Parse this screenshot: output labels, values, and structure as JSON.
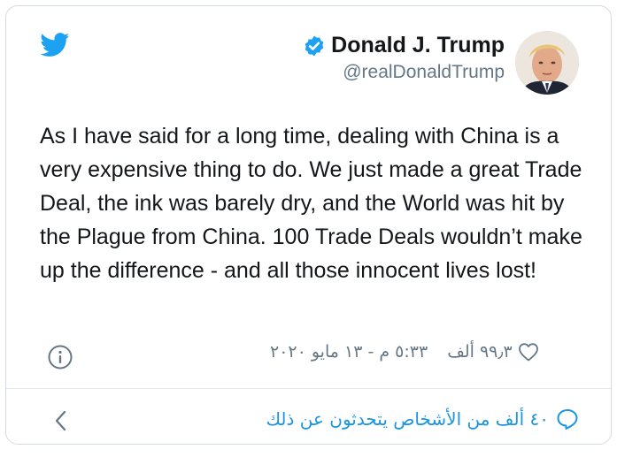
{
  "author": {
    "name": "Donald J. Trump",
    "handle": "@realDonaldTrump",
    "verified": true,
    "avatar_icon": "profile-photo"
  },
  "tweet": {
    "text": "As I have said for a long time, dealing with China is a very expensive thing to do. We just made a great Trade Deal, the ink was barely dry, and the World was hit by the Plague from China. 100 Trade Deals wouldn’t make up the difference - and all those innocent lives lost!"
  },
  "meta": {
    "timestamp": "٥:٣٣ م - ١٣ مايو ٢٠٢٠",
    "likes": "٩٩٫٣ ألف"
  },
  "footer": {
    "conversation_text": "٤٠ ألف من الأشخاص يتحدثون عن ذلك"
  },
  "icons": {
    "platform": "twitter-bird-icon",
    "verified": "verified-badge-icon",
    "info": "info-icon",
    "like": "heart-icon",
    "reply": "speech-bubble-icon",
    "back": "chevron-left-icon"
  },
  "colors": {
    "brand_blue": "#1da1f2",
    "link_blue": "#1b95e0",
    "text": "#14171a",
    "muted": "#657786",
    "border": "#d4dce3"
  }
}
